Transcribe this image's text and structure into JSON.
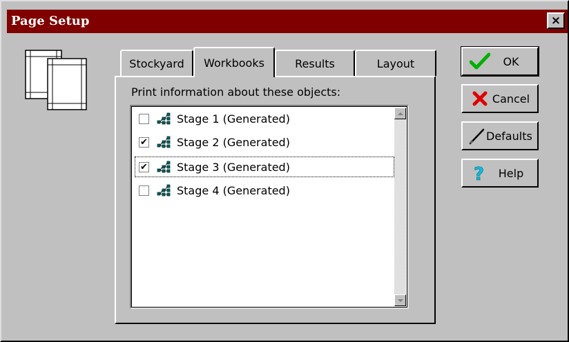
{
  "window": {
    "title": "Page Setup",
    "close_glyph": "×"
  },
  "tabs": [
    {
      "label": "Stockyard",
      "active": false
    },
    {
      "label": "Workbooks",
      "active": true
    },
    {
      "label": "Results",
      "active": false
    },
    {
      "label": "Layout",
      "active": false
    }
  ],
  "panel": {
    "label": "Print information about these objects:",
    "items": [
      {
        "label": "Stage 1 (Generated)",
        "checked": false,
        "check_glyph": "",
        "icon": "stage-network-icon"
      },
      {
        "label": "Stage 2 (Generated)",
        "checked": true,
        "check_glyph": "✔",
        "icon": "stage-network-icon"
      },
      {
        "label": "Stage 3 (Generated)",
        "checked": true,
        "check_glyph": "✔",
        "icon": "stage-network-icon",
        "focused": true
      },
      {
        "label": "Stage 4 (Generated)",
        "checked": false,
        "check_glyph": "",
        "icon": "stage-network-icon"
      }
    ]
  },
  "buttons": {
    "ok": "OK",
    "cancel": "Cancel",
    "defaults": "Defaults",
    "help": "Help"
  },
  "icons": {
    "ok": "checkmark-icon",
    "cancel": "red-x-icon",
    "defaults": "pen-icon",
    "help": "question-icon",
    "page": "pages-icon"
  },
  "colors": {
    "titlebar": "#800000",
    "face": "#c0c0c0",
    "ok_check": "#00b000",
    "cancel_x": "#e00000",
    "help_q": "#00c0e0"
  }
}
